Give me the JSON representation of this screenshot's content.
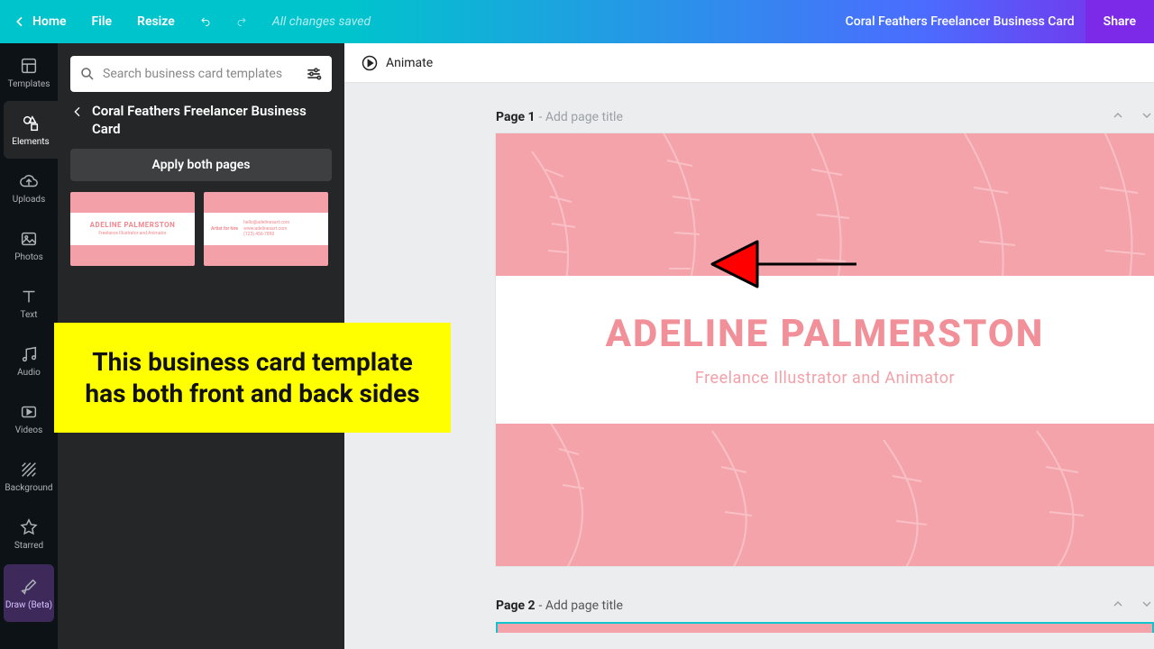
{
  "colors": {
    "accent": "#00c4cc",
    "purple": "#7d2ae8",
    "coral": "#f5a3ab",
    "coral_text": "#f19099"
  },
  "topbar": {
    "home": "Home",
    "file": "File",
    "resize": "Resize",
    "saved": "All changes saved",
    "doc_title": "Coral Feathers Freelancer Business Card",
    "share": "Share"
  },
  "rail": [
    {
      "key": "templates",
      "label": "Templates"
    },
    {
      "key": "elements",
      "label": "Elements"
    },
    {
      "key": "uploads",
      "label": "Uploads"
    },
    {
      "key": "photos",
      "label": "Photos"
    },
    {
      "key": "text",
      "label": "Text"
    },
    {
      "key": "audio",
      "label": "Audio"
    },
    {
      "key": "videos",
      "label": "Videos"
    },
    {
      "key": "background",
      "label": "Background"
    },
    {
      "key": "starred",
      "label": "Starred"
    },
    {
      "key": "draw",
      "label": "Draw (Beta)"
    }
  ],
  "panel": {
    "search_placeholder": "Search business card templates",
    "title": "Coral Feathers Freelancer Business Card",
    "apply": "Apply both pages",
    "thumb1_name": "ADELINE PALMERSTON",
    "thumb1_sub": "Freelance Illustrator and Animator",
    "thumb2_left": "Artist for hire",
    "thumb2_right": "hello@adelinesart.com\nwww.adelinesart.com\n(123) 456-7890"
  },
  "canvas": {
    "animate": "Animate",
    "page1_label": "Page 1",
    "page2_label": "Page 2",
    "page_hint": " - Add page title",
    "name": "ADELINE PALMERSTON",
    "subtitle": "Freelance Illustrator and Animator"
  },
  "note": "This business card template has both front and back sides"
}
